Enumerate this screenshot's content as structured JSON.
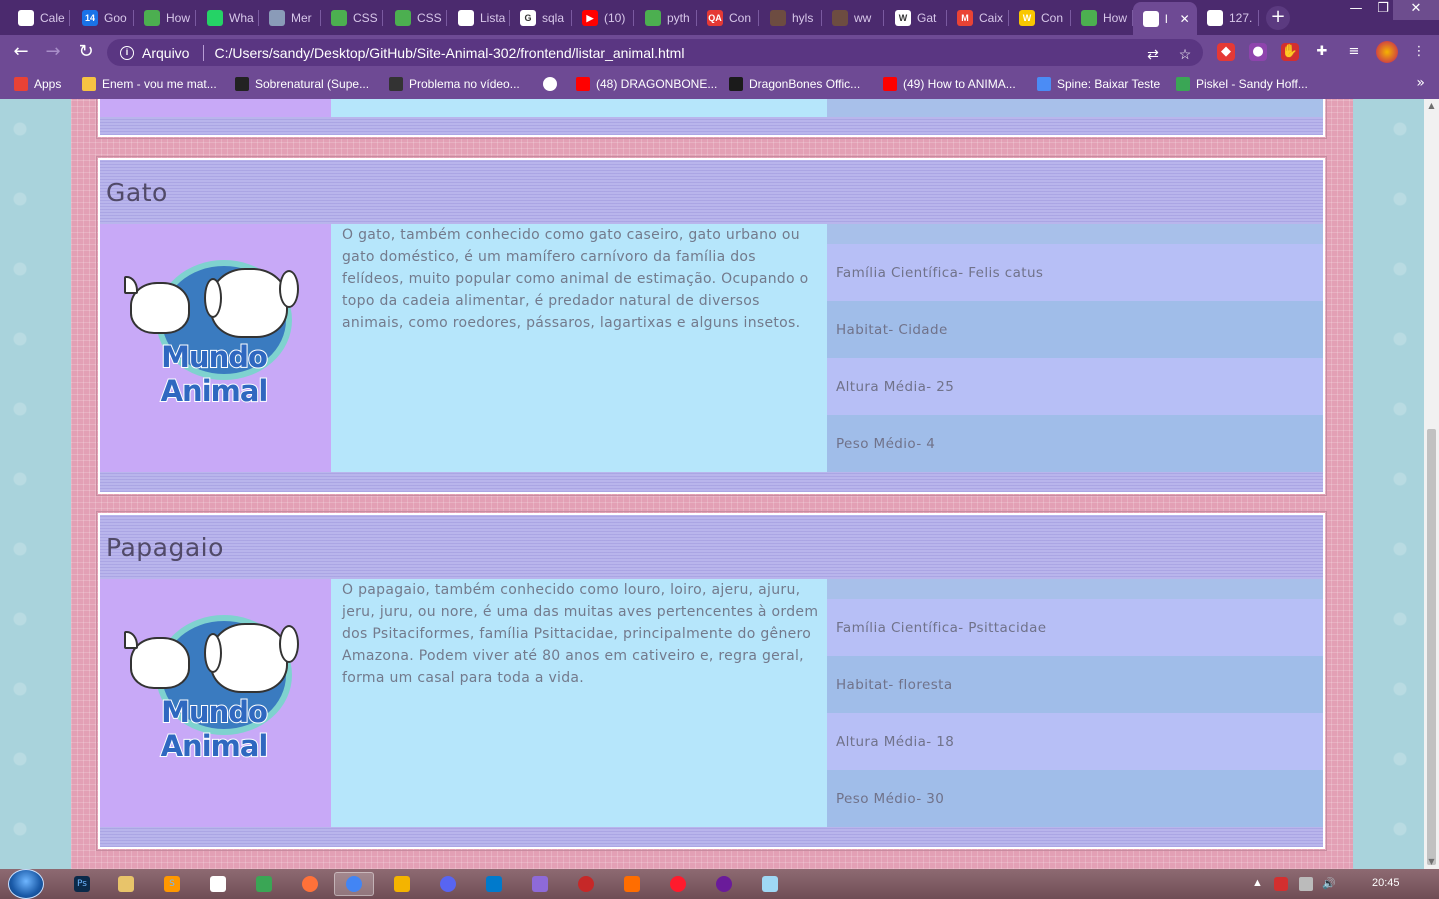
{
  "browser": {
    "tabs": [
      {
        "label": "Cale",
        "fav_color": "#ffffff",
        "fav_glyph": ""
      },
      {
        "label": "Goo",
        "fav_color": "#1a73e8",
        "fav_glyph": "14"
      },
      {
        "label": "How",
        "fav_color": "#4caf50",
        "fav_glyph": ""
      },
      {
        "label": "Wha",
        "fav_color": "#25d366",
        "fav_glyph": ""
      },
      {
        "label": "Mer",
        "fav_color": "#8a9bb8",
        "fav_glyph": ""
      },
      {
        "label": "CSS",
        "fav_color": "#4caf50",
        "fav_glyph": ""
      },
      {
        "label": "CSS",
        "fav_color": "#4caf50",
        "fav_glyph": ""
      },
      {
        "label": "Lista",
        "fav_color": "#ffffff",
        "fav_glyph": ""
      },
      {
        "label": "sqla",
        "fav_color": "#ffffff",
        "fav_glyph": "G"
      },
      {
        "label": "(10)",
        "fav_color": "#ff0000",
        "fav_glyph": "▶"
      },
      {
        "label": "pyth",
        "fav_color": "#4caf50",
        "fav_glyph": ""
      },
      {
        "label": "Con",
        "fav_color": "#e53935",
        "fav_glyph": "QA"
      },
      {
        "label": "hyls",
        "fav_color": "#6d4c41",
        "fav_glyph": ""
      },
      {
        "label": "ww",
        "fav_color": "#6d4c41",
        "fav_glyph": ""
      },
      {
        "label": "Gat",
        "fav_color": "#ffffff",
        "fav_glyph": "W"
      },
      {
        "label": "Caix",
        "fav_color": "#ea4335",
        "fav_glyph": "M"
      },
      {
        "label": "Con",
        "fav_color": "#f9c700",
        "fav_glyph": "W"
      },
      {
        "label": "How",
        "fav_color": "#4caf50",
        "fav_glyph": ""
      },
      {
        "label": "l",
        "fav_color": "#ffffff",
        "fav_glyph": "",
        "active": true
      },
      {
        "label": "127.",
        "fav_color": "#ffffff",
        "fav_glyph": ""
      }
    ],
    "new_tab_label": "+",
    "window_controls": {
      "minimize": "—",
      "maximize": "❐",
      "close": "✕"
    },
    "address": {
      "scheme_label": "Arquivo",
      "url": "C:/Users/sandy/Desktop/GitHub/Site-Animal-302/frontend/listar_animal.html"
    },
    "bookmarks": [
      {
        "label": "Apps",
        "color": "#e94235"
      },
      {
        "label": "Enem - vou me mat...",
        "color": "#f6c343"
      },
      {
        "label": "Sobrenatural (Supe...",
        "color": "#222222"
      },
      {
        "label": "Problema no vídeo...",
        "color": "#333333"
      },
      {
        "label": "",
        "color": "#ffffff"
      },
      {
        "label": "(48) DRAGONBONE...",
        "color": "#ff0000"
      },
      {
        "label": "DragonBones Offic...",
        "color": "#1b1b1b"
      },
      {
        "label": "(49) How to ANIMA...",
        "color": "#ff0000"
      },
      {
        "label": "Spine: Baixar Teste",
        "color": "#4b8cf5"
      },
      {
        "label": "Piskel - Sandy Hoff...",
        "color": "#3aa655"
      }
    ],
    "bookmarks_more": "»"
  },
  "page": {
    "animals": [
      {
        "name": "Gato",
        "description": "O gato, também conhecido como gato caseiro, gato urbano ou gato doméstico, é um mamífero carnívoro da família dos felídeos, muito popular como animal de estimação. Ocupando o topo da cadeia alimentar, é predador natural de diversos animais, como roedores, pássaros, lagartixas e alguns insetos.",
        "familia": "Família Científica- Felis catus",
        "habitat": "Habitat- Cidade",
        "altura": "Altura Média- 25",
        "peso": "Peso Médio- 4",
        "logo_text": "Mundo Animal"
      },
      {
        "name": "Papagaio",
        "description": "O papagaio, também conhecido como louro, loiro, ajeru, ajuru, jeru, juru, ou nore, é uma das muitas aves pertencentes à ordem dos Psitaciformes, família Psittacidae, principalmente do gênero Amazona. Podem viver até 80 anos em cativeiro e, regra geral, forma um casal para toda a vida.",
        "familia": "Família Científica- Psittacidae",
        "habitat": "Habitat- floresta",
        "altura": "Altura Média- 18",
        "peso": "Peso Médio- 30",
        "logo_text": "Mundo Animal"
      }
    ]
  },
  "taskbar": {
    "apps": [
      {
        "name": "photoshop",
        "glyph": "Ps",
        "color": "#0b2a4a"
      },
      {
        "name": "explorer",
        "glyph": "",
        "color": "#e8c46a"
      },
      {
        "name": "sublime",
        "glyph": "S",
        "color": "#ff9800"
      },
      {
        "name": "notepad",
        "glyph": "",
        "color": "#ffffff"
      },
      {
        "name": "app-green",
        "glyph": "",
        "color": "#3aa655"
      },
      {
        "name": "firefox",
        "glyph": "",
        "color": "#ff7139"
      },
      {
        "name": "chrome",
        "glyph": "",
        "color": "#4285f4",
        "active": true
      },
      {
        "name": "pencil",
        "glyph": "",
        "color": "#f4b400"
      },
      {
        "name": "discord",
        "glyph": "",
        "color": "#5865f2"
      },
      {
        "name": "vscode",
        "glyph": "",
        "color": "#007acc"
      },
      {
        "name": "app-purple",
        "glyph": "",
        "color": "#8e6ad8"
      },
      {
        "name": "app-red",
        "glyph": "",
        "color": "#c62828"
      },
      {
        "name": "app-orange",
        "glyph": "",
        "color": "#ff6d00"
      },
      {
        "name": "opera",
        "glyph": "",
        "color": "#ff1b2d"
      },
      {
        "name": "app-circle",
        "glyph": "",
        "color": "#6a1b9a"
      },
      {
        "name": "app-star",
        "glyph": "",
        "color": "#9fd8f5"
      }
    ],
    "tray_arrow": "▲",
    "clock": "20:45"
  },
  "colors": {
    "tabbar_bg": "#4b2a6e",
    "toolbar_bg": "#6e4a94",
    "page_bg": "#a9d3dc",
    "wrapper_pink": "#e3a0b5",
    "card_lilac": "#b9b5ec",
    "logo_col": "#c8a9f7",
    "desc_col": "#b6e6fb",
    "attr_odd": "#b7bff6",
    "attr_even": "#a0bde9"
  }
}
